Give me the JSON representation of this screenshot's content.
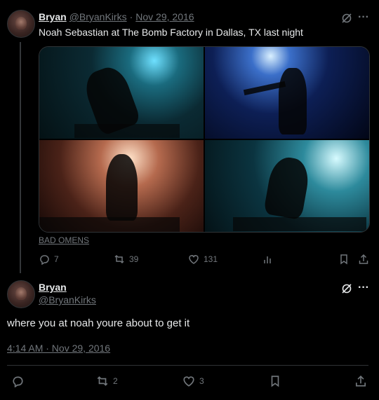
{
  "tweet1": {
    "name": "Bryan",
    "handle": "@BryanKirks",
    "separator": "·",
    "date": "Nov 29, 2016",
    "text": "Noah Sebastian at The Bomb Factory in Dallas, TX last night",
    "tag": "BAD OMENS",
    "replies": "7",
    "retweets": "39",
    "likes": "131"
  },
  "tweet2": {
    "name": "Bryan",
    "handle": "@BryanKirks",
    "text": "where you at noah youre about to get it",
    "timestamp": "4:14 AM · Nov 29, 2016",
    "retweets": "2",
    "likes": "3"
  },
  "icons": {
    "grok": "grok-icon",
    "more": "more-icon",
    "reply": "reply-icon",
    "retweet": "retweet-icon",
    "like": "like-icon",
    "views": "views-icon",
    "bookmark": "bookmark-icon",
    "share": "share-icon"
  },
  "colors": {
    "background": "#000000",
    "text": "#e7e9ea",
    "muted": "#71767b",
    "border": "#2f3336"
  }
}
